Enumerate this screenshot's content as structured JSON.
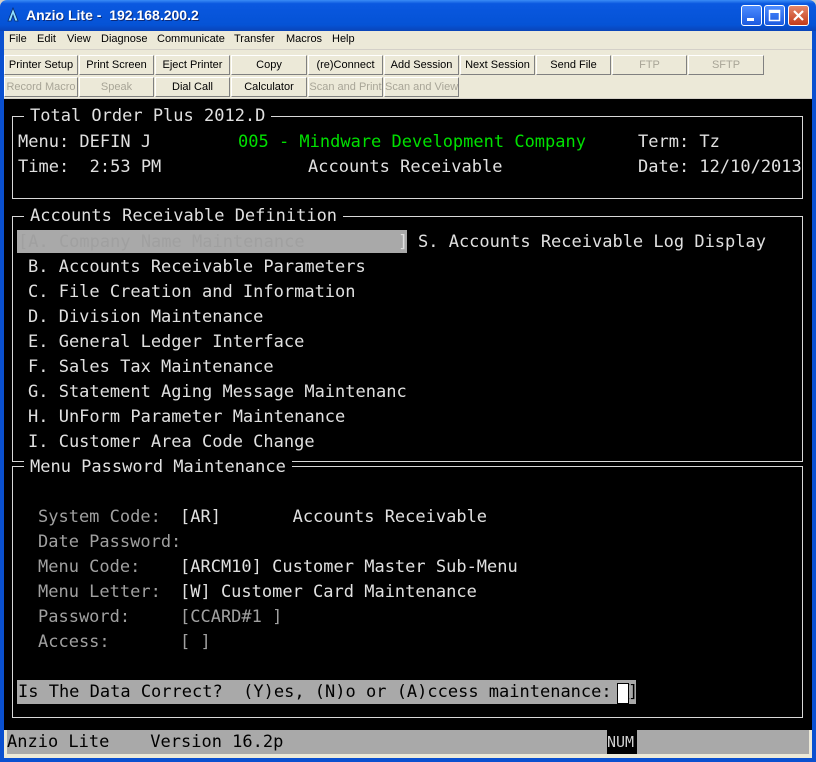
{
  "window": {
    "title": "Anzio Lite -  192.168.200.2",
    "app_icon": "anzio-lite-icon"
  },
  "menubar": [
    "File",
    "Edit",
    "View",
    "Diagnose",
    "Communicate",
    "Transfer",
    "Macros",
    "Help"
  ],
  "toolbar": {
    "row1": [
      {
        "label": "Printer Setup",
        "enabled": true
      },
      {
        "label": "Print Screen",
        "enabled": true
      },
      {
        "label": "Eject Printer",
        "enabled": true
      },
      {
        "label": "Copy",
        "enabled": true
      },
      {
        "label": "(re)Connect",
        "enabled": true
      },
      {
        "label": "Add Session",
        "enabled": true
      },
      {
        "label": "Next Session",
        "enabled": true
      },
      {
        "label": "Send File",
        "enabled": true
      },
      {
        "label": "FTP",
        "enabled": false
      },
      {
        "label": "SFTP",
        "enabled": false
      }
    ],
    "row2": [
      {
        "label": "Record Macro",
        "enabled": false
      },
      {
        "label": "Speak",
        "enabled": false
      },
      {
        "label": "Dial Call",
        "enabled": true
      },
      {
        "label": "Calculator",
        "enabled": true
      },
      {
        "label": "Scan and Print",
        "enabled": false
      },
      {
        "label": "Scan and View",
        "enabled": false
      }
    ]
  },
  "terminal": {
    "header": {
      "box_title": "Total Order Plus 2012.D",
      "menu_label": "Menu: DEFIN J",
      "company": "005 - Mindware Development Company",
      "term": "Term: Tz",
      "time": "Time:  2:53 PM",
      "module": "Accounts Receivable",
      "date": "Date: 12/10/2013"
    },
    "menu_box": {
      "title": "Accounts Receivable Definition",
      "selected_item": "[A. Company Name Maintenance",
      "selected_close": "]",
      "side_item": "S. Accounts Receivable Log Display",
      "items": [
        "B. Accounts Receivable Parameters",
        "C. File Creation and Information",
        "D. Division Maintenance",
        "E. General Ledger Interface",
        "F. Sales Tax Maintenance",
        "G. Statement Aging Message Maintenanc",
        "H. UnForm Parameter Maintenance",
        "I. Customer Area Code Change"
      ]
    },
    "password_box": {
      "title": "Menu Password Maintenance",
      "fields": [
        {
          "label": "System Code:",
          "value": "[AR]       Accounts Receivable"
        },
        {
          "label": "Date Password:",
          "value": ""
        },
        {
          "label": "Menu Code:",
          "value": "[ARCM10] Customer Master Sub-Menu"
        },
        {
          "label": "Menu Letter:",
          "value": "[W] Customer Card Maintenance"
        },
        {
          "label": "Password:",
          "value": "[CCARD#1 ]"
        },
        {
          "label": "Access:",
          "value": "[ ]"
        }
      ],
      "prompt": "Is The Data Correct?  (Y)es, (N)o or (A)ccess maintenance: [",
      "prompt_close": "]"
    }
  },
  "statusbar": {
    "left": "Anzio Lite    Version 16.2p",
    "num": "NUM"
  }
}
